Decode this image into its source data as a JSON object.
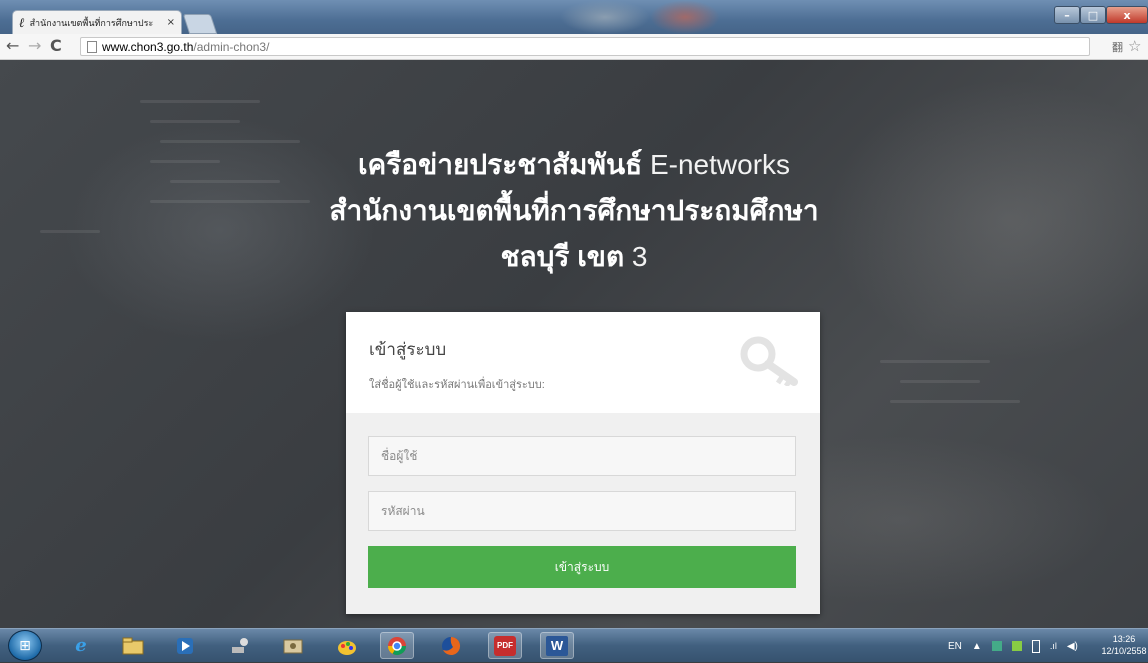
{
  "browser": {
    "tab_title": "สำนักงานเขตพื้นที่การศึกษาประ",
    "tab_favicon": "ℓ",
    "tab_close": "×",
    "url_host": "www.chon3.go.th",
    "url_path": "/admin-chon3/",
    "back_icon": "←",
    "forward_icon": "→",
    "reload_icon": "C",
    "translate_icon": "翻",
    "bookmark_icon": "☆"
  },
  "window_controls": {
    "minimize": "–",
    "maximize": "□",
    "close": "x"
  },
  "heading": {
    "line1_bold": "เครือข่ายประชาสัมพันธ์",
    "line1_thin": " E-networks",
    "line2": "สำนักงานเขตพื้นที่การศึกษาประถมศึกษา",
    "line3_bold": "ชลบุรี เขต",
    "line3_thin": " 3"
  },
  "login": {
    "title": "เข้าสู่ระบบ",
    "subtitle": "ใส่ชื่อผู้ใช้และรหัสผ่านเพื่อเข้าสู่ระบบ:",
    "username_placeholder": "ชื่อผู้ใช้",
    "password_placeholder": "รหัสผ่าน",
    "submit_label": "เข้าสู่ระบบ",
    "key_icon": "key-icon"
  },
  "taskbar": {
    "items": [
      "start-orb",
      "internet-explorer-icon",
      "file-explorer-icon",
      "media-player-icon",
      "network-icon",
      "photo-icon",
      "paint-icon",
      "chrome-icon",
      "firefox-icon",
      "pdf-icon",
      "word-icon"
    ],
    "pdf_label": "PDF",
    "word_label": "W",
    "lang": "EN",
    "tray_arrow": "▲",
    "clock_time": "13:26",
    "clock_date": "12/10/2558"
  },
  "colors": {
    "accent_green": "#4cae4c",
    "card_bg": "#ffffff",
    "card_body_bg": "#f0f0f0"
  }
}
